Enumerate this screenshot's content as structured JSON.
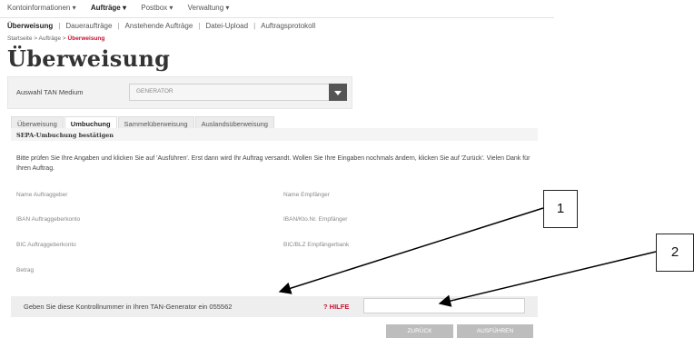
{
  "topnav": {
    "items": [
      "Kontoinformationen ▾",
      "Aufträge ▾",
      "Postbox ▾",
      "Verwaltung ▾"
    ]
  },
  "subnav": {
    "items": [
      "Überweisung",
      "Daueraufträge",
      "Anstehende Aufträge",
      "Datei-Upload",
      "Auftragsprotokoll"
    ]
  },
  "breadcrumb": {
    "start": "Startseite",
    "sep1": " > ",
    "section": "Aufträge",
    "sep2": " > ",
    "current": "Überweisung"
  },
  "page_title": "Überweisung",
  "tan_medium": {
    "label": "Auswahl TAN Medium",
    "value": "GENERATOR"
  },
  "tabs": [
    "Überweisung",
    "Umbuchung",
    "Sammelüberweisung",
    "Auslandsüberweisung"
  ],
  "panel": {
    "title": "SEPA-Umbuchung bestätigen",
    "info": "Bitte prüfen Sie Ihre Angaben und klicken Sie auf 'Ausführen'. Erst dann wird Ihr Auftrag versandt. Wollen Sie Ihre Eingaben nochmals ändern, klicken Sie auf 'Zurück'. Vielen Dank für Ihren Auftrag."
  },
  "fields": {
    "name_auftraggeber": "Name Auftraggeber",
    "iban_auftraggeber": "IBAN Auftraggeberkonto",
    "bic_auftraggeber": "BIC Auftraggeberkonto",
    "betrag": "Betrag",
    "name_empfaenger": "Name Empfänger",
    "iban_empfaenger": "IBAN/Kto.Nr. Empfänger",
    "bic_empfaenger": "BIC/BLZ Empfängerbank"
  },
  "kontroll": {
    "text": "Geben Sie diese Kontrollnummer in Ihren TAN-Generator ein 055562",
    "help": "? HILFE",
    "input_value": ""
  },
  "buttons": {
    "back": "ZURÜCK",
    "execute": "AUSFÜHREN"
  },
  "callouts": [
    "1",
    "2"
  ]
}
